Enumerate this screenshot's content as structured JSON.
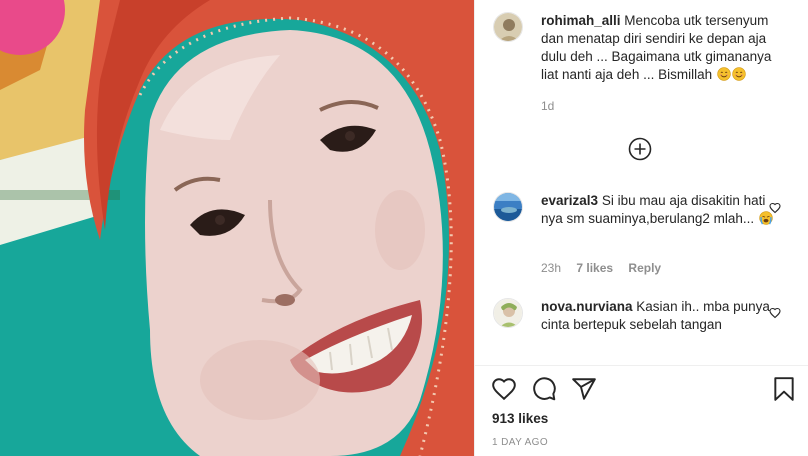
{
  "post": {
    "author": "rohimah_alli",
    "caption": "Mencoba utk tersenyum dan menatap diri sendiri ke depan aja dulu deh ... Bagaimana utk gimananya liat nanti aja deh ... Bismillah",
    "caption_emoji": [
      "smiling-face-emoji",
      "smiling-face-emoji"
    ],
    "time": "1d"
  },
  "load_more_icon": "plus-circle-icon",
  "comments": [
    {
      "username": "evarizal3",
      "text": "Si ibu mau aja disakitin hati nya sm suaminya,berulang2 mlah...",
      "emoji": "loudly-crying-face-emoji",
      "time": "23h",
      "likes": "7 likes",
      "reply": "Reply"
    },
    {
      "username": "nova.nurviana",
      "text": "Kasian ih.. mba punya cinta bertepuk sebelah tangan"
    }
  ],
  "actions": {
    "like_icon": "heart-icon",
    "comment_icon": "comment-icon",
    "share_icon": "paper-plane-icon",
    "save_icon": "bookmark-icon"
  },
  "likes_count": "913 likes",
  "date_label": "1 DAY AGO",
  "colors": {
    "text": "#262626",
    "muted": "#8e8e8e",
    "border": "#efefef",
    "hijab": "#d9533b",
    "background_teal": "#17a79a"
  }
}
